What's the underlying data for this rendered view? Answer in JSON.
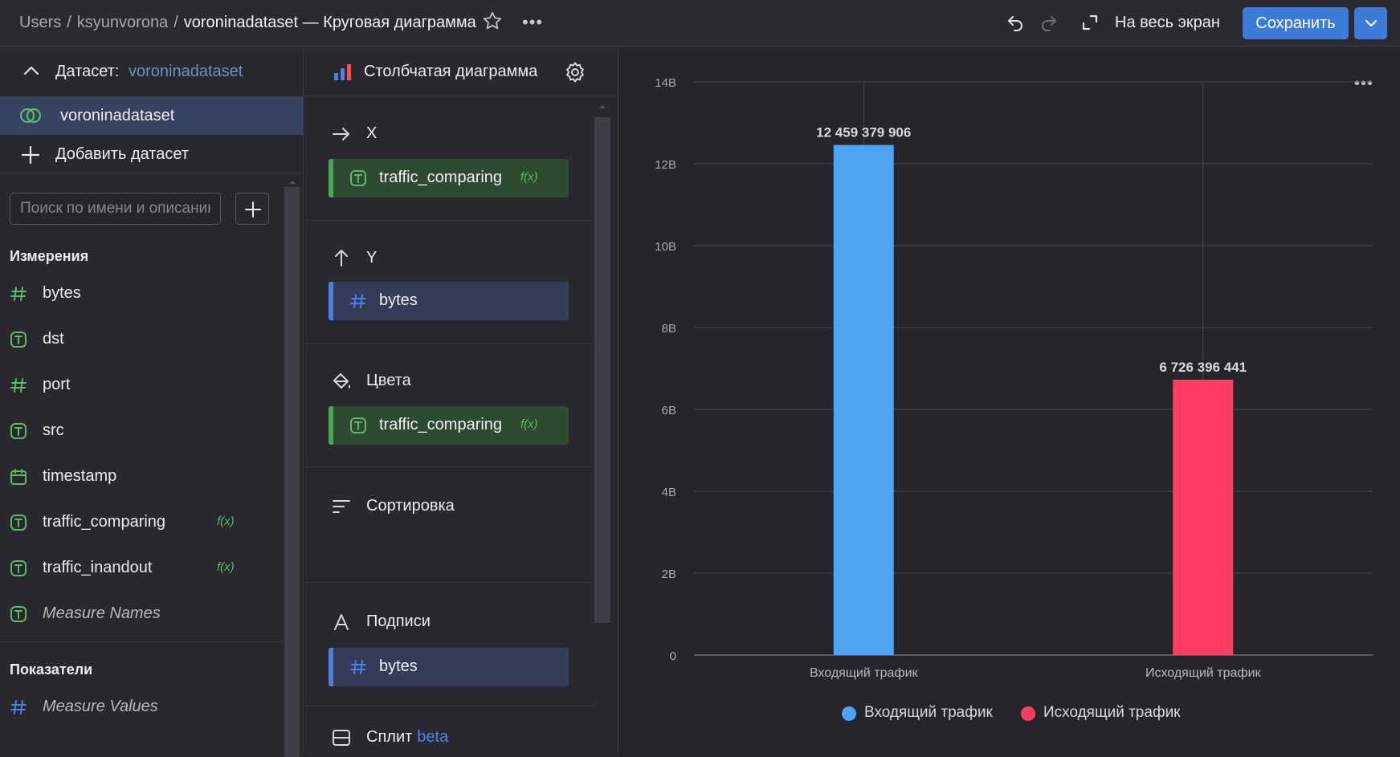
{
  "header": {
    "breadcrumb": [
      "Users",
      "ksyunvorona",
      "voroninadataset — Круговая диаграмма"
    ],
    "fullscreen_label": "На весь экран",
    "save_label": "Сохранить"
  },
  "left_panel": {
    "dataset_label": "Датасет:",
    "dataset_name": "voroninadataset",
    "selected_dataset": "voroninadataset",
    "add_dataset_label": "Добавить датасет",
    "search_placeholder": "Поиск по имени и описанию",
    "dimensions_title": "Измерения",
    "dimensions": [
      {
        "name": "bytes",
        "type": "number-icon",
        "formula": ""
      },
      {
        "name": "dst",
        "type": "text-icon",
        "formula": ""
      },
      {
        "name": "port",
        "type": "number-icon",
        "formula": ""
      },
      {
        "name": "src",
        "type": "text-icon",
        "formula": ""
      },
      {
        "name": "timestamp",
        "type": "calendar-icon",
        "formula": ""
      },
      {
        "name": "traffic_comparing",
        "type": "text-icon",
        "formula": "f(x)"
      },
      {
        "name": "traffic_inandout",
        "type": "text-icon",
        "formula": "f(x)"
      },
      {
        "name": "Measure Names",
        "type": "text-icon",
        "formula": ""
      }
    ],
    "measures_title": "Показатели",
    "measures": [
      {
        "name": "Measure Values",
        "type": "number-icon"
      }
    ]
  },
  "middle_panel": {
    "viz_type": "Столбчатая диаграмма",
    "sections": {
      "x": {
        "title": "X",
        "field": "traffic_comparing",
        "formula": "f(x)"
      },
      "y": {
        "title": "Y",
        "field": "bytes"
      },
      "colors": {
        "title": "Цвета",
        "field": "traffic_comparing",
        "formula": "f(x)"
      },
      "sort": {
        "title": "Сортировка"
      },
      "labels": {
        "title": "Подписи",
        "field": "bytes"
      },
      "split": {
        "title": "Сплит",
        "badge": "beta"
      }
    }
  },
  "colors": {
    "accent": "#3d7bdb",
    "incoming": "#4ea3f2",
    "outgoing": "#ff3d64",
    "dimension_icon": "#5fb86a",
    "measure_icon": "#4d7fe4"
  },
  "chart_data": {
    "type": "bar",
    "categories": [
      "Входящий трафик",
      "Исходящий трафик"
    ],
    "values": [
      12459379906,
      6726396441
    ],
    "value_labels": [
      "12 459 379 906",
      "6 726 396 441"
    ],
    "ylim": [
      0,
      14000000000
    ],
    "y_ticks": [
      "0",
      "2B",
      "4B",
      "6B",
      "8B",
      "10B",
      "12B",
      "14B"
    ],
    "series": [
      {
        "name": "Входящий трафик",
        "color": "#4ea3f2"
      },
      {
        "name": "Исходящий трафик",
        "color": "#ff3d64"
      }
    ],
    "grid": true,
    "legend": "bottom"
  }
}
